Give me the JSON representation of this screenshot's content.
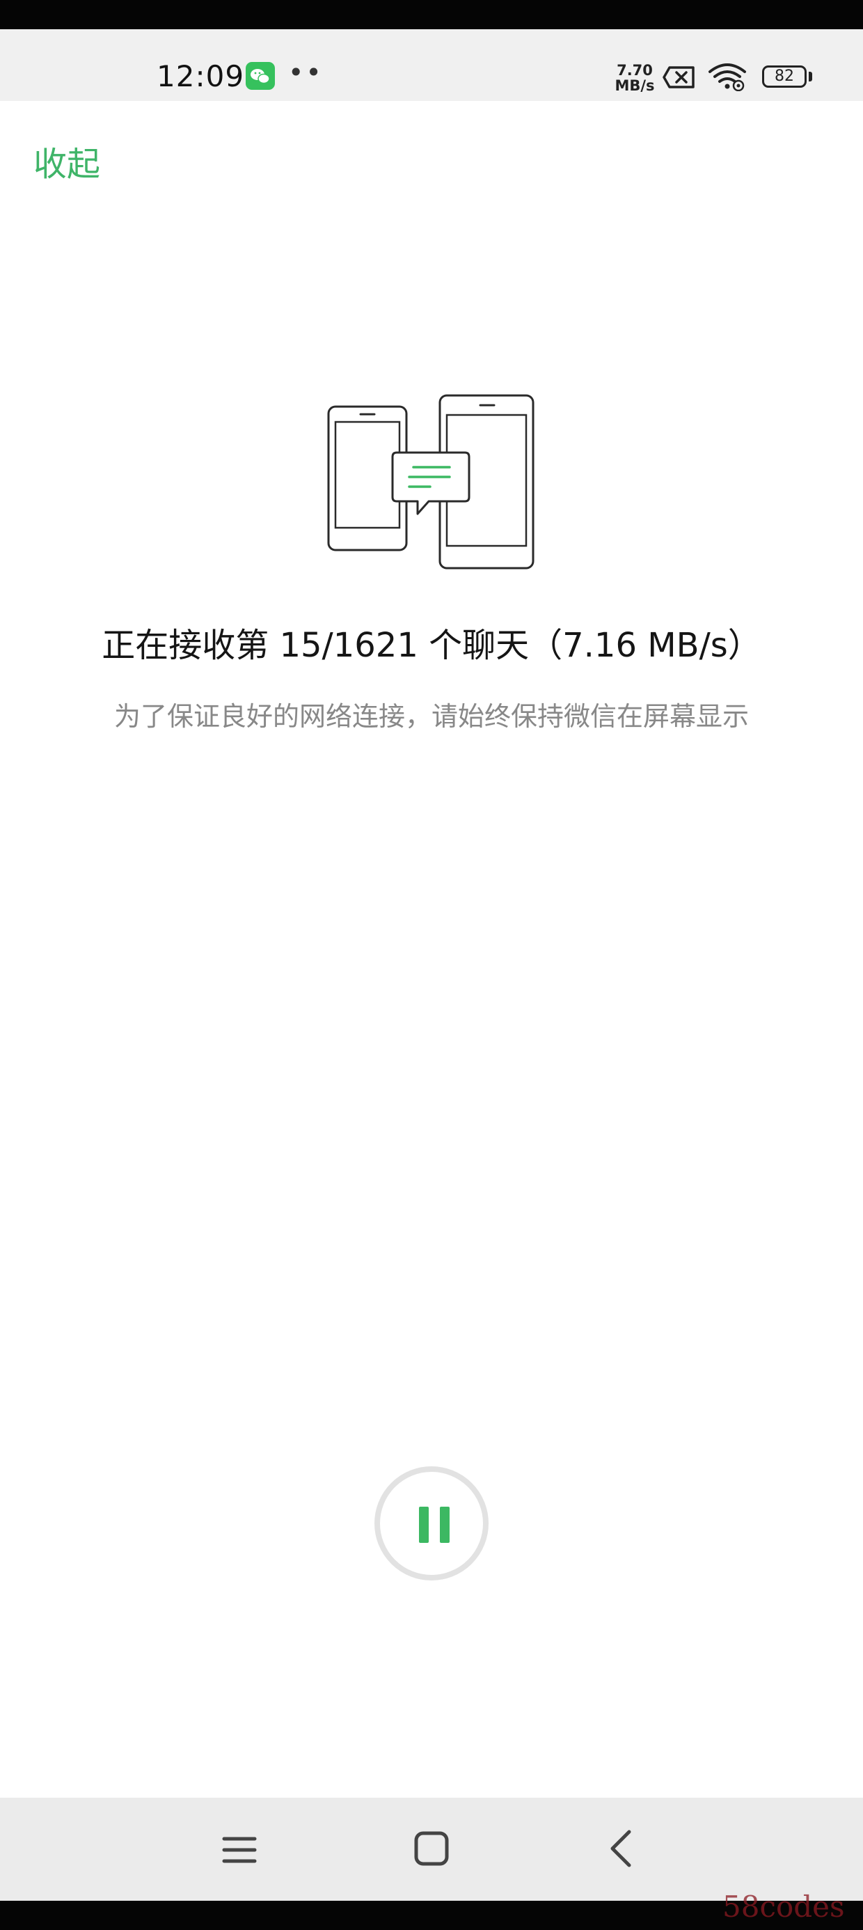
{
  "status_bar": {
    "time": "12:09",
    "dots": "••",
    "net_speed_value": "7.70",
    "net_speed_unit": "MB/s",
    "battery": "82",
    "icons": [
      "wechat-icon",
      "sim-disabled-icon",
      "wifi-icon",
      "battery-icon"
    ]
  },
  "header": {
    "collapse_label": "收起"
  },
  "transfer": {
    "illustration_icon": "phone-transfer-icon",
    "progress_text": "正在接收第 15/1621 个聊天（7.16 MB/s）",
    "hint_text": "为了保证良好的网络连接，请始终保持微信在屏幕显示",
    "current_chat": 15,
    "total_chats": 1621,
    "speed": "7.16 MB/s"
  },
  "controls": {
    "pause_icon": "pause-icon"
  },
  "nav_bar": {
    "icons": [
      "menu-icon",
      "home-icon",
      "back-icon"
    ]
  },
  "watermark": {
    "text": "58codes"
  },
  "colors": {
    "accent": "#3fb468",
    "pause_green": "#3cb862",
    "status_bar_bg": "#f0f0f0",
    "nav_bar_bg": "#ebebeb",
    "hint_gray": "#888888"
  }
}
